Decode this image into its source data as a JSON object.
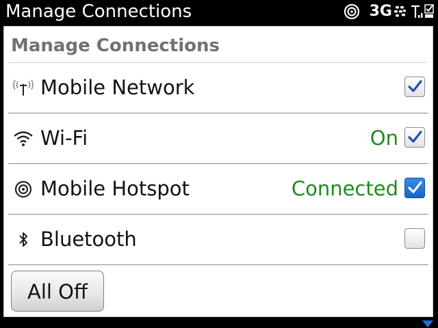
{
  "statusbar": {
    "title": "Manage Connections",
    "network": "3G",
    "icons": [
      "hotspot-icon",
      "blackberry-logo-icon",
      "signal-bars-icon",
      "checkmark-icon"
    ]
  },
  "panel": {
    "header": "Manage Connections",
    "rows": [
      {
        "icon": "antenna-icon",
        "label": "Mobile Network",
        "status": "",
        "checked": true,
        "selected": false
      },
      {
        "icon": "wifi-icon",
        "label": "Wi-Fi",
        "status": "On",
        "checked": true,
        "selected": false
      },
      {
        "icon": "hotspot-icon",
        "label": "Mobile Hotspot",
        "status": "Connected",
        "checked": true,
        "selected": true
      },
      {
        "icon": "bluetooth-icon",
        "label": "Bluetooth",
        "status": "",
        "checked": false,
        "selected": false
      }
    ],
    "all_off_label": "All Off"
  },
  "colors": {
    "status_green": "#1e8a1e",
    "check_blue": "#1d4fae",
    "selection_blue": "#1463c8",
    "header_gray": "#6e7378"
  }
}
